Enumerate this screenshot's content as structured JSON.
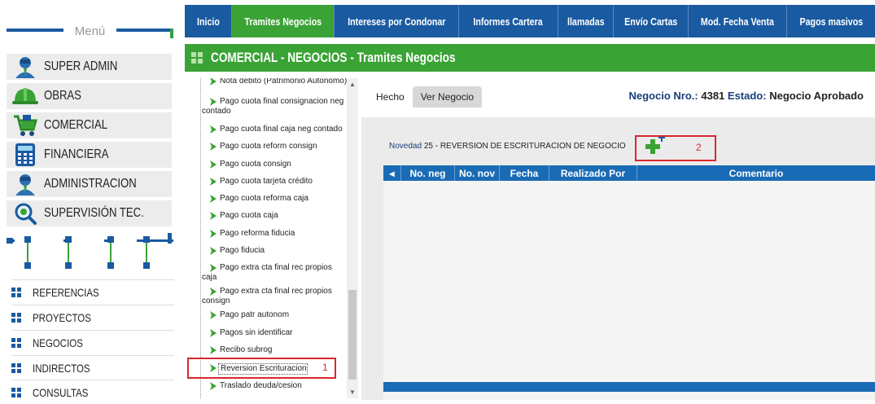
{
  "sidebar": {
    "menu_title": "Menú",
    "roles": [
      {
        "label": "SUPER ADMIN",
        "icon": "user-icon"
      },
      {
        "label": "OBRAS",
        "icon": "hardhat-icon"
      },
      {
        "label": "COMERCIAL",
        "icon": "cart-icon"
      },
      {
        "label": "FINANCIERA",
        "icon": "calculator-icon"
      },
      {
        "label": "ADMINISTRACION",
        "icon": "user-icon"
      },
      {
        "label": "SUPERVISIÓN TEC.",
        "icon": "magnifier-icon"
      }
    ],
    "links": [
      "REFERENCIAS",
      "PROYECTOS",
      "NEGOCIOS",
      "INDIRECTOS",
      "CONSULTAS"
    ]
  },
  "topnav": {
    "tabs": [
      "Inicio",
      "Tramites Negocios",
      "Intereses por Condonar",
      "Informes Cartera",
      "llamadas",
      "Envío Cartas",
      "Mod. Fecha Venta",
      "Pagos masivos"
    ],
    "active": "Tramites Negocios"
  },
  "header": {
    "title": "COMERCIAL - NEGOCIOS - Tramites Negocios"
  },
  "tree": {
    "items": [
      "Nota debito (Patrimonio Autonomo)",
      "Pago cuota final consignacion neg contado",
      "Pago cuota final caja neg contado",
      "Pago cuota reform consign",
      "Pago cuota consign",
      "Pago cuota tarjeta crédito",
      "Pago cuota reforma caja",
      "Pago cuota caja",
      "Pago reforma fiducia",
      "Pago fiducia",
      "Pago extra cta final rec propios caja",
      "Pago extra cta final rec propios consign",
      "Pago patr autonom",
      "Pagos sin identificar",
      "Recibo subrog",
      "Reversion Escrituracion",
      "Traslado deuda/cesion"
    ],
    "selected": "Reversion Escrituracion"
  },
  "content": {
    "subtabs": [
      "Hecho",
      "Ver Negocio"
    ],
    "negocio_label": "Negocio Nro.:",
    "negocio_nro": "4381",
    "estado_label": "Estado:",
    "estado_value": "Negocio Aprobado",
    "novedad_label": "Novedad",
    "novedad_value": "25 - REVERSION DE ESCRITURACION DE NEGOCIO",
    "grid_columns": [
      "No. neg",
      "No. nov",
      "Fecha",
      "Realizado Por",
      "Comentario"
    ]
  },
  "annotations": {
    "label1": "1",
    "label2": "2"
  },
  "colors": {
    "nav_blue": "#1a5aa0",
    "active_green": "#3aa335",
    "grid_blue": "#1a6bb5",
    "annotation_red": "#d9272e"
  }
}
